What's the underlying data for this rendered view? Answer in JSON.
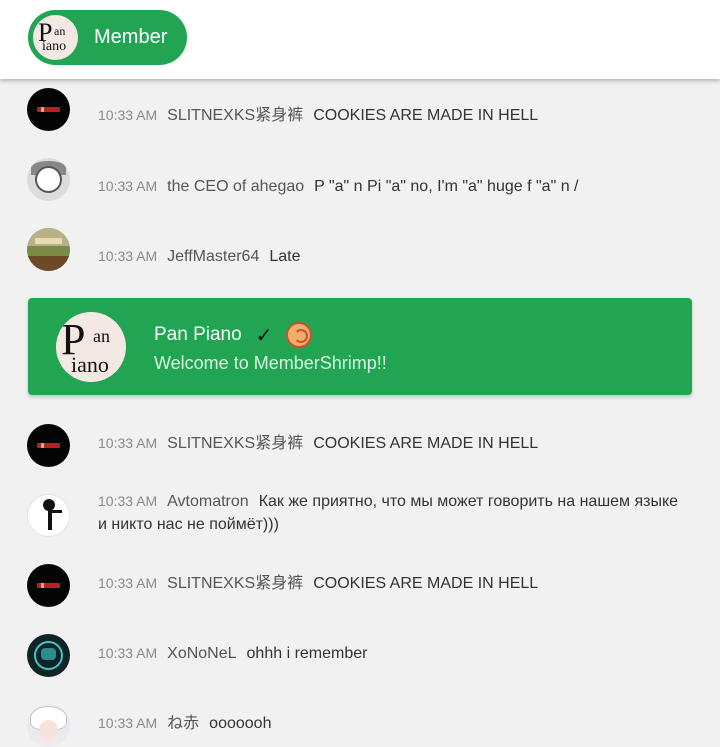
{
  "header": {
    "member_label": "Member",
    "logo_text": {
      "p": "P",
      "an": "an",
      "iano": "iano"
    }
  },
  "messages": [
    {
      "time": "10:33 AM",
      "user": "SLITNEXKS紧身裤",
      "text": "COOKIES ARE MADE IN HELL",
      "avatar": "dark-logo"
    },
    {
      "time": "10:33 AM",
      "user": "the CEO of ahegao",
      "text": "P \"a\" n Pi \"a\" no, I'm \"a\" huge f \"a\" n /",
      "avatar": "manga"
    },
    {
      "time": "10:33 AM",
      "user": "JeffMaster64",
      "text": "Late",
      "avatar": "game"
    },
    {
      "time": "10:33 AM",
      "user": "SLITNEXKS紧身裤",
      "text": "COOKIES ARE MADE IN HELL",
      "avatar": "dark-logo"
    },
    {
      "time": "10:33 AM",
      "user": "Avtomatron",
      "text": "Как же приятно, что мы может говорить на нашем языке и никто нас не поймёт)))",
      "avatar": "stick-figure"
    },
    {
      "time": "10:33 AM",
      "user": "SLITNEXKS紧身裤",
      "text": "COOKIES ARE MADE IN HELL",
      "avatar": "dark-logo"
    },
    {
      "time": "10:33 AM",
      "user": "XoNoNeL",
      "text": "ohhh i remember",
      "avatar": "teal-mask"
    },
    {
      "time": "10:33 AM",
      "user": "ね赤",
      "text": "ooooooh",
      "avatar": "anime-girl"
    }
  ],
  "welcome_card": {
    "name": "Pan Piano",
    "check_icon": "✓",
    "badge_icon": "shrimp-icon",
    "message": "Welcome to MemberShrimp!!"
  },
  "colors": {
    "accent_green": "#21a552",
    "background": "#f1f1f1",
    "timestamp": "#8a8a8a"
  }
}
